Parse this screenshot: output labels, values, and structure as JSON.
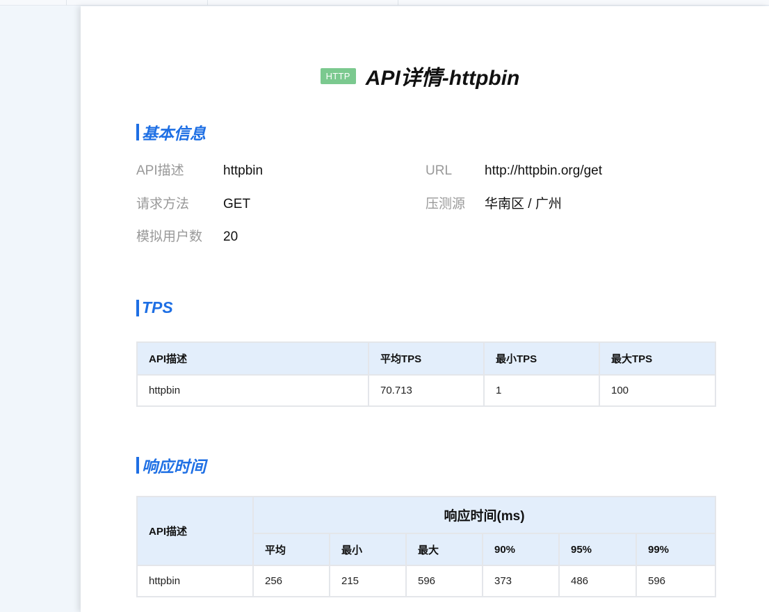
{
  "header": {
    "badge": "HTTP",
    "title": "API详情-httpbin"
  },
  "basic_info": {
    "section_title": "基本信息",
    "rows": [
      {
        "label": "API描述",
        "value": "httpbin"
      },
      {
        "label": "URL",
        "value": "http://httpbin.org/get"
      },
      {
        "label": "请求方法",
        "value": "GET"
      },
      {
        "label": "压测源",
        "value": "华南区 / 广州"
      },
      {
        "label": "模拟用户数",
        "value": "20"
      }
    ]
  },
  "tps": {
    "section_title": "TPS",
    "headers": [
      "API描述",
      "平均TPS",
      "最小TPS",
      "最大TPS"
    ],
    "rows": [
      [
        "httpbin",
        "70.713",
        "1",
        "100"
      ]
    ]
  },
  "response_time": {
    "section_title": "响应时间",
    "api_header": "API描述",
    "group_header": "响应时间(ms)",
    "sub_headers": [
      "平均",
      "最小",
      "最大",
      "90%",
      "95%",
      "99%"
    ],
    "rows": [
      [
        "httpbin",
        "256",
        "215",
        "596",
        "373",
        "486",
        "596"
      ]
    ]
  },
  "colors": {
    "accent": "#1e6fe4",
    "badge": "#7bc98f",
    "header_bg": "#e3eefb",
    "border": "#e4e6ea"
  }
}
